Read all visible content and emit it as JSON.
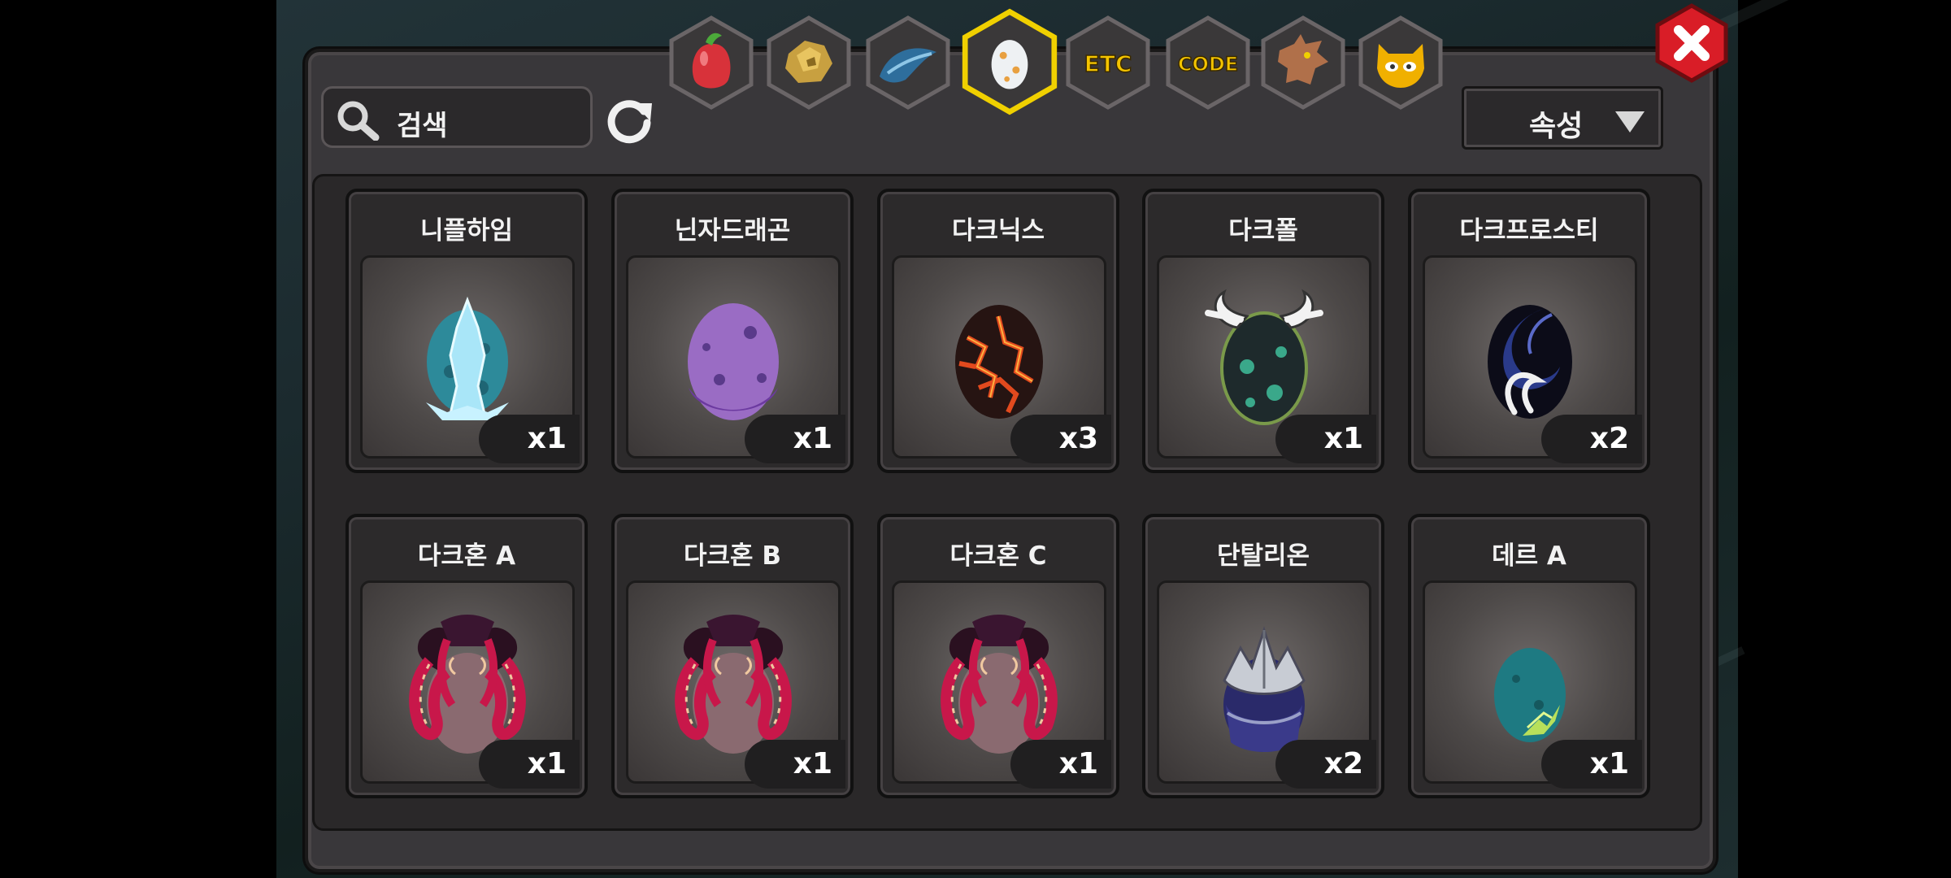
{
  "search": {
    "placeholder": "검색"
  },
  "filter": {
    "label": "속성"
  },
  "tabs": [
    {
      "name": "fruit-tab",
      "icon": "red-fruit-icon"
    },
    {
      "name": "ore-tab",
      "icon": "gold-ore-icon"
    },
    {
      "name": "feather-tab",
      "icon": "blue-feather-icon"
    },
    {
      "name": "egg-tab",
      "icon": "egg-icon",
      "selected": true
    },
    {
      "name": "etc-tab",
      "label": "ETC"
    },
    {
      "name": "code-tab",
      "label": "CODE"
    },
    {
      "name": "dragon-tab",
      "icon": "dragon-head-icon"
    },
    {
      "name": "mask-tab",
      "icon": "golden-mask-icon"
    }
  ],
  "items": [
    {
      "name": "니플하임",
      "qty": "x1",
      "egg": "ice"
    },
    {
      "name": "닌자드래곤",
      "qty": "x1",
      "egg": "purple"
    },
    {
      "name": "다크닉스",
      "qty": "x3",
      "egg": "lava"
    },
    {
      "name": "다크폴",
      "qty": "x1",
      "egg": "horned"
    },
    {
      "name": "다크프로스티",
      "qty": "x2",
      "egg": "swirl"
    },
    {
      "name": "다크혼 A",
      "qty": "x1",
      "egg": "tentacle"
    },
    {
      "name": "다크혼 B",
      "qty": "x1",
      "egg": "tentacle"
    },
    {
      "name": "다크혼 C",
      "qty": "x1",
      "egg": "tentacle"
    },
    {
      "name": "단탈리온",
      "qty": "x2",
      "egg": "armored"
    },
    {
      "name": "데르 A",
      "qty": "x1",
      "egg": "teal"
    }
  ],
  "colors": {
    "accent": "#f0d000",
    "close": "#d91d27",
    "panel": "#39373a"
  }
}
